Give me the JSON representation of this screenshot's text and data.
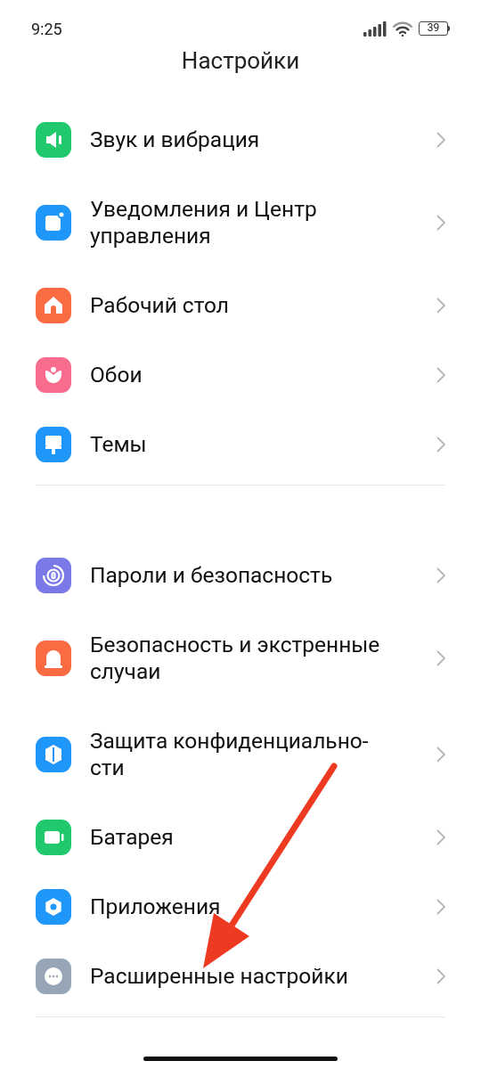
{
  "status_bar": {
    "time": "9:25",
    "battery": "39"
  },
  "title": "Настройки",
  "sections": [
    {
      "items": [
        {
          "label": "Звук и вибрация",
          "kind": "sound",
          "color": "#20c96b"
        },
        {
          "label": "Уведомления и Центр управления",
          "kind": "notifications",
          "color": "#1e96fa"
        },
        {
          "label": "Рабочий стол",
          "kind": "home",
          "color": "#fb6b42"
        },
        {
          "label": "Обои",
          "kind": "wallpaper",
          "color": "#f86c8d"
        },
        {
          "label": "Темы",
          "kind": "themes",
          "color": "#1e96fa"
        }
      ]
    },
    {
      "items": [
        {
          "label": "Пароли и безопасность",
          "kind": "passwords",
          "color": "#7a79e8"
        },
        {
          "label": "Безопасность и экстренные случаи",
          "kind": "emergency",
          "color": "#fb6b42"
        },
        {
          "label": "Защита конфиденциально-сти",
          "kind": "privacy",
          "color": "#1e96fa"
        },
        {
          "label": "Батарея",
          "kind": "battery",
          "color": "#20c96b"
        },
        {
          "label": "Приложения",
          "kind": "apps",
          "color": "#1e96fa"
        },
        {
          "label": "Расширенные настройки",
          "kind": "more",
          "color": "#97a6b6"
        }
      ]
    }
  ]
}
